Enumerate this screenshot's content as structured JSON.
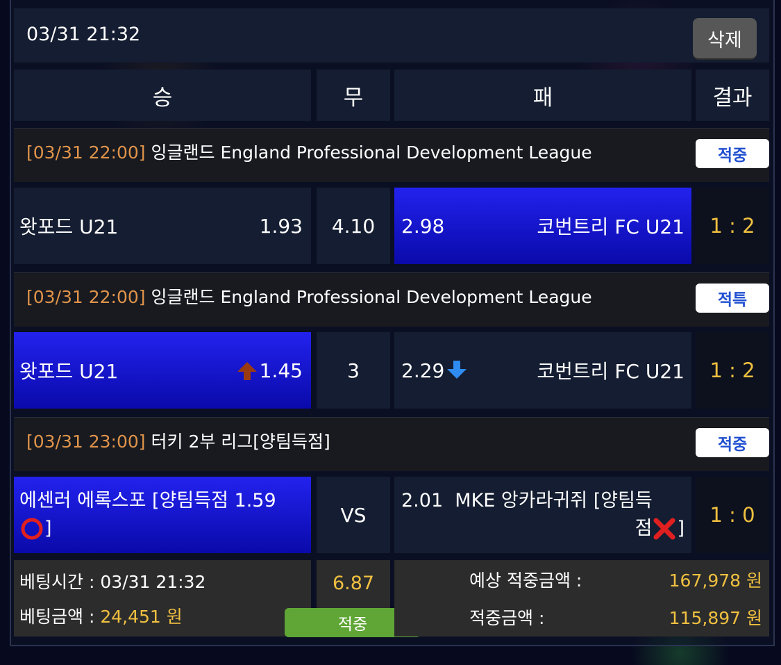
{
  "header": {
    "datetime": "03/31 21:32",
    "delete_label": "삭제"
  },
  "columns": {
    "win": "승",
    "draw": "무",
    "loss": "패",
    "result": "결과"
  },
  "matches": [
    {
      "time": "[03/31 22:00]",
      "league": "잉글랜드 England Professional Development League",
      "tag": "적중",
      "home": "왓포드 U21",
      "home_odds": "1.93",
      "draw": "4.10",
      "away_odds": "2.98",
      "away": "코번트리 FC U21",
      "score": "1 : 2"
    },
    {
      "time": "[03/31 22:00]",
      "league": "잉글랜드 England Professional Development League",
      "tag": "적특",
      "home": "왓포드 U21",
      "home_odds": "1.45",
      "draw": "3",
      "away_odds": "2.29",
      "away": "코번트리 FC U21",
      "score": "1 : 2"
    },
    {
      "time": "[03/31 23:00]",
      "league": "터키 2부 리그[양팀득점]",
      "tag": "적중",
      "home_line1": "에센러 에록스포 [양팀득점 1.59",
      "home_line2": "]",
      "draw": "VS",
      "away_line1": "2.01  MKE 앙카라귀쥐 [양팀득",
      "away_line2": "점",
      "away_line2_end": "]",
      "score": "1 : 0"
    }
  ],
  "summary": {
    "bet_time_label": "베팅시간 : ",
    "bet_time": "03/31 21:32",
    "bet_amount_label": "베팅금액 : ",
    "bet_amount": "24,451 원",
    "total_odds": "6.87",
    "status": "적중",
    "expected_label": "예상 적중금액 :",
    "expected_amount": "167,978 원",
    "won_label": "적중금액 :",
    "won_amount": "115,897 원"
  },
  "colors": {
    "highlight_blue": "#1a1ad8",
    "gold": "#f0c040",
    "orange_time": "#e0944a",
    "tag_text": "#1f4fd0",
    "status_green": "#5fa636"
  }
}
